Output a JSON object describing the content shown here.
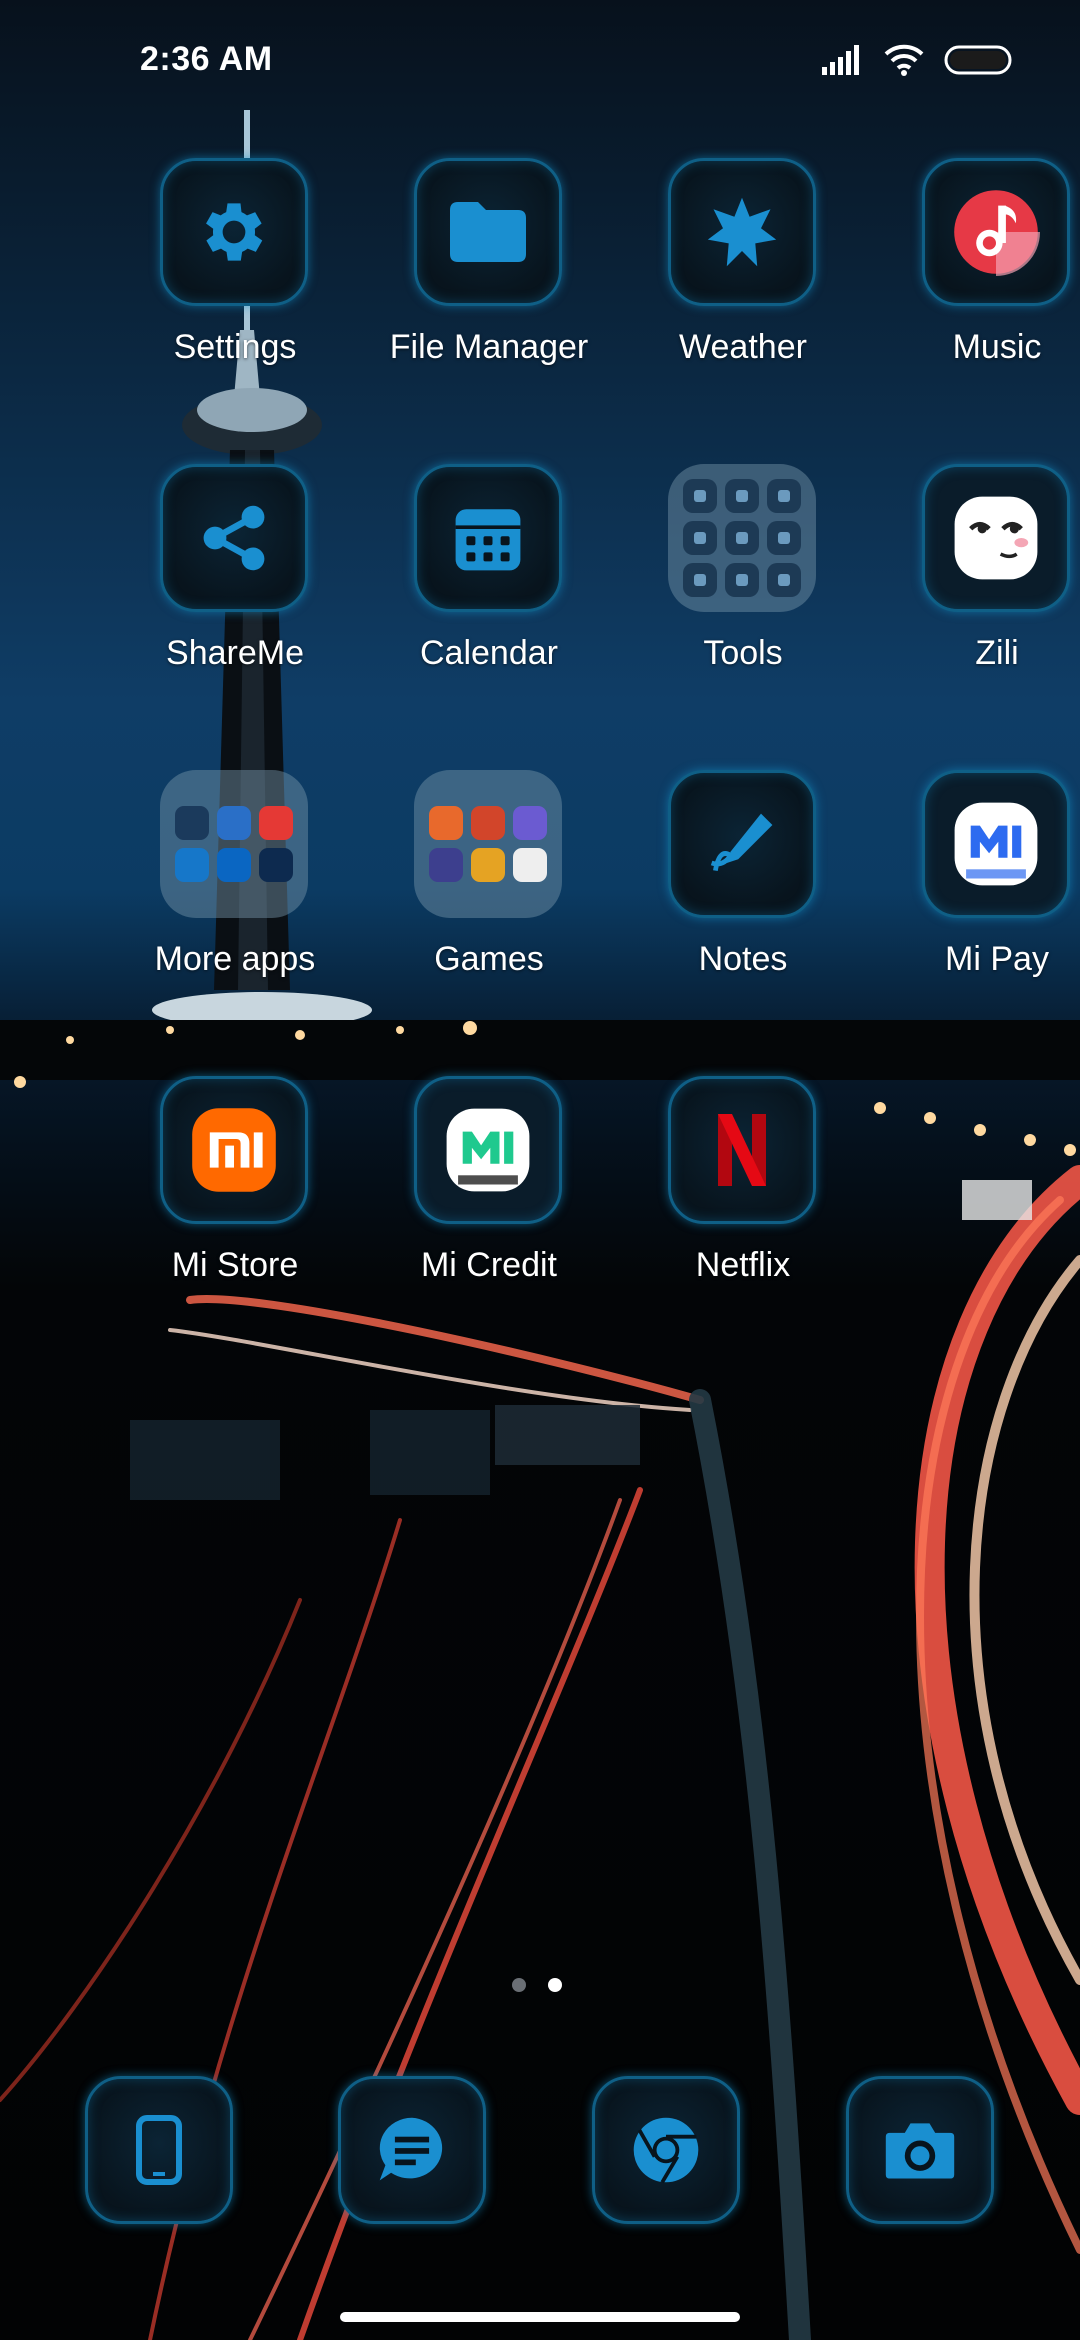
{
  "status_bar": {
    "time": "2:36 AM",
    "icons": [
      "signal-icon",
      "wifi-icon",
      "battery-icon"
    ]
  },
  "apps": [
    {
      "label": "Settings",
      "icon": "gear-icon"
    },
    {
      "label": "File Manager",
      "icon": "folder-icon"
    },
    {
      "label": "Weather",
      "icon": "weather-icon"
    },
    {
      "label": "Music",
      "icon": "music-icon"
    },
    {
      "label": "ShareMe",
      "icon": "share-icon"
    },
    {
      "label": "Calendar",
      "icon": "calendar-icon"
    },
    {
      "label": "Tools",
      "icon": "tools-folder"
    },
    {
      "label": "Zili",
      "icon": "zili-icon"
    },
    {
      "label": "More apps",
      "icon": "more-apps-folder"
    },
    {
      "label": "Games",
      "icon": "games-folder"
    },
    {
      "label": "Notes",
      "icon": "notes-icon"
    },
    {
      "label": "Mi Pay",
      "icon": "mi-pay-icon"
    },
    {
      "label": "Mi Store",
      "icon": "mi-store-icon"
    },
    {
      "label": "Mi Credit",
      "icon": "mi-credit-icon"
    },
    {
      "label": "Netflix",
      "icon": "netflix-icon"
    }
  ],
  "page_indicator": {
    "pages": 2,
    "active": 2
  },
  "dock": [
    "phone-icon",
    "messages-icon",
    "browser-icon",
    "camera-icon"
  ],
  "colors": {
    "accent": "#1a8fd0",
    "tile_border": "#0f5f86",
    "music_red": "#e63946",
    "netflix_red": "#e50914",
    "mi_orange": "#ff6900",
    "mi_credit_green": "#1fc98e"
  }
}
